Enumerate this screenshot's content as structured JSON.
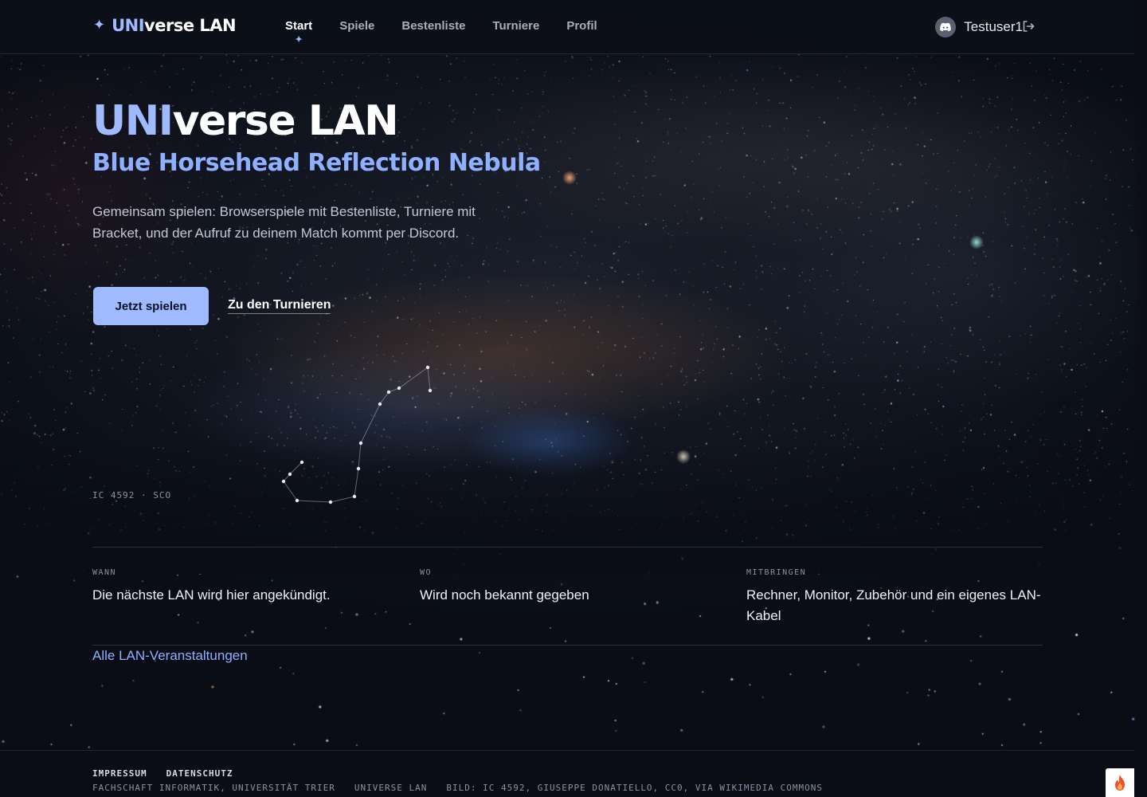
{
  "header": {
    "brand_uni": "UNI",
    "brand_rest": "verse LAN",
    "nav": [
      {
        "label": "Start",
        "active": true
      },
      {
        "label": "Spiele",
        "active": false
      },
      {
        "label": "Bestenliste",
        "active": false
      },
      {
        "label": "Turniere",
        "active": false
      },
      {
        "label": "Profil",
        "active": false
      }
    ],
    "username": "Testuser1"
  },
  "hero": {
    "title_uni": "UNI",
    "title_rest": "verse LAN",
    "subtitle": "Blue Horsehead Reflection Nebula",
    "description": "Gemeinsam spielen: Browserspiele mit Bestenliste, Turniere mit Bracket, und der Aufruf zu deinem Match kommt per Discord.",
    "primary_button": "Jetzt spielen",
    "secondary_link": "Zu den Turnieren",
    "caption": "IC 4592 · SCO"
  },
  "info": {
    "when_label": "WANN",
    "when_value": "Die nächste LAN wird hier angekündigt.",
    "where_label": "WO",
    "where_value": "Wird noch bekannt gegeben",
    "bring_label": "MITBRINGEN",
    "bring_value": "Rechner, Monitor, Zubehör und ein eigenes LAN-Kabel",
    "all_events_link": "Alle LAN-Veranstaltungen"
  },
  "footer": {
    "impressum": "IMPRESSUM",
    "datenschutz": "DATENSCHUTZ",
    "org": "FACHSCHAFT INFORMATIK, UNIVERSITÄT TRIER",
    "site": "UNIVERSE LAN",
    "image_credit": "BILD: IC 4592, GIUSEPPE DONATIELLO, CC0, VIA WIKIMEDIA COMMONS"
  },
  "colors": {
    "accent": "#9fbaff",
    "background": "#0a0d16",
    "text": "#e6e9f2",
    "muted": "#8a91a3"
  },
  "icons": {
    "brand": "sparkle-icon",
    "avatar": "discord-icon",
    "logout": "logout-icon",
    "corner": "flame-icon"
  }
}
